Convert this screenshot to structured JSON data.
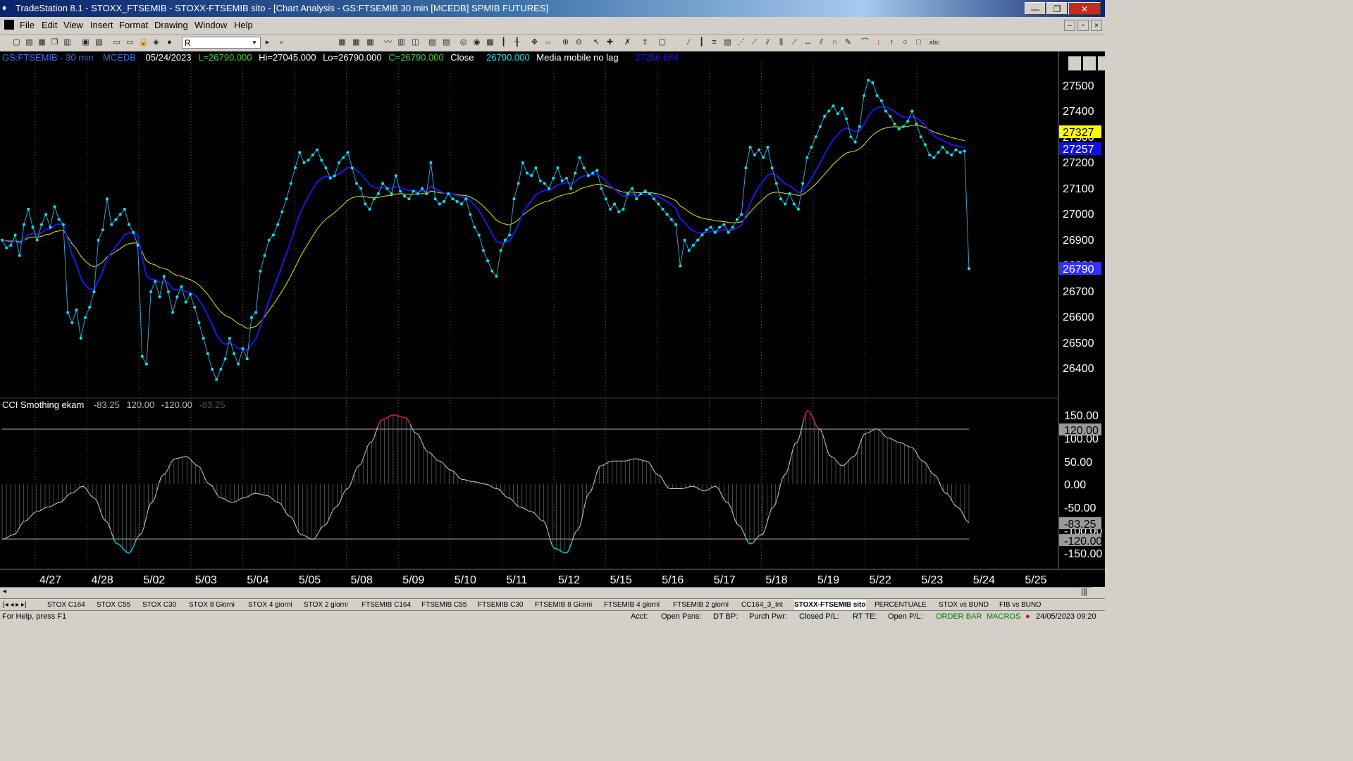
{
  "window": {
    "title": "TradeStation 8.1 - STOXX_FTSEMIB - STOXX-FTSEMIB sito - [Chart Analysis - GS:FTSEMIB  30 min  [MCEDB] SPMIB FUTURES]",
    "minimize": "—",
    "restore": "❐",
    "close": "✕"
  },
  "menu": [
    "File",
    "Edit",
    "View",
    "Insert",
    "Format",
    "Drawing",
    "Window",
    "Help"
  ],
  "toolbar": {
    "symbol_value": "R"
  },
  "chart": {
    "header": {
      "symbol": "GS:FTSEMIB - 30 min",
      "source": "MCEDB",
      "date": "05/24/2023",
      "last": "L=26790.000",
      "high": "Hi=27045.000",
      "low": "Lo=26790.000",
      "close": "C=26790.000",
      "close_label": "Close",
      "close_val": "26790.000",
      "ma_label": "Media mobile no lag",
      "ma_val": "27256.684"
    },
    "price_axis": [
      "27500",
      "27400",
      "27300",
      "27200",
      "27100",
      "27000",
      "26900",
      "26800",
      "26700",
      "26600",
      "26500",
      "26400"
    ],
    "price_tags": {
      "yellow": "27327",
      "blue": "27257",
      "last": "26790"
    },
    "indicator": {
      "name": "CCI Smothing ekam",
      "v1": "-83.25",
      "v2": "120.00",
      "v3": "-120.00",
      "v4": "-83.25"
    },
    "ind_axis": [
      "150.00",
      "100.00",
      "50.00",
      "0.00",
      "-50.00",
      "-100.00",
      "-150.00"
    ],
    "ind_tags": {
      "upper": "120.00",
      "current": "-83.25",
      "lower": "-120.00"
    },
    "dates": [
      "4/27",
      "4/28",
      "5/02",
      "5/03",
      "5/04",
      "5/05",
      "5/08",
      "5/09",
      "5/10",
      "5/11",
      "5/12",
      "5/15",
      "5/16",
      "5/17",
      "5/18",
      "5/19",
      "5/22",
      "5/23",
      "5/24",
      "5/25"
    ],
    "colors": {
      "price": "#00e5ff",
      "ma_blue": "#1010e0",
      "ma_yellow": "#e6e600",
      "cci_up": "#d02020",
      "cci_down": "#00bcd4"
    }
  },
  "chart_data": {
    "type": "line",
    "title": "GS:FTSEMIB - 30 min",
    "x_label": "",
    "y_label": "",
    "ylim": [
      26300,
      27550
    ],
    "series": [
      {
        "name": "Close",
        "days": [
          "4/27",
          "4/28",
          "5/02",
          "5/03",
          "5/04",
          "5/05",
          "5/08",
          "5/09",
          "5/10",
          "5/11",
          "5/12",
          "5/15",
          "5/16",
          "5/17",
          "5/18",
          "5/19",
          "5/22",
          "5/23",
          "5/24"
        ],
        "values": [
          26900,
          26600,
          26950,
          26650,
          26400,
          26800,
          27200,
          27050,
          27080,
          26850,
          27150,
          27150,
          27050,
          26900,
          27200,
          27400,
          27450,
          27250,
          26790
        ]
      },
      {
        "name": "Media mobile no lag",
        "last": 27256.684
      }
    ],
    "indicator": {
      "name": "CCI Smothing ekam",
      "ylim": [
        -160,
        160
      ],
      "levels": [
        120,
        -120
      ],
      "last": -83.25
    }
  },
  "tabs": [
    "STOX C164",
    "STOX C55",
    "STOX  C30",
    "STOX  8 Giorni",
    "STOX 4 giorni",
    "STOX  2 giorni",
    "FTSEMIB C164",
    "FTSEMIB C55",
    "FTSEMIB C30",
    "FTSEMIB  8 Giorni",
    "FTSEMIB  4 giorni",
    "FTSEMIB  2 giorni",
    "CC164_3_Int",
    "STOXX-FTSEMIB sito",
    "PERCENTUALE",
    "STOX vs BUND",
    "FIB vs BUND"
  ],
  "status": {
    "help": "For Help, press F1",
    "acct": "Acct:",
    "open_psns": "Open Psns:",
    "dt_bp": "DT BP:",
    "purch_pwr": "Purch Pwr:",
    "closed_pl": "Closed P/L:",
    "rt_te": "RT TE:",
    "open_pl": "Open P/L:",
    "order_bar": "ORDER BAR",
    "macros": "MACROS",
    "datetime": "24/05/2023 09:20"
  }
}
